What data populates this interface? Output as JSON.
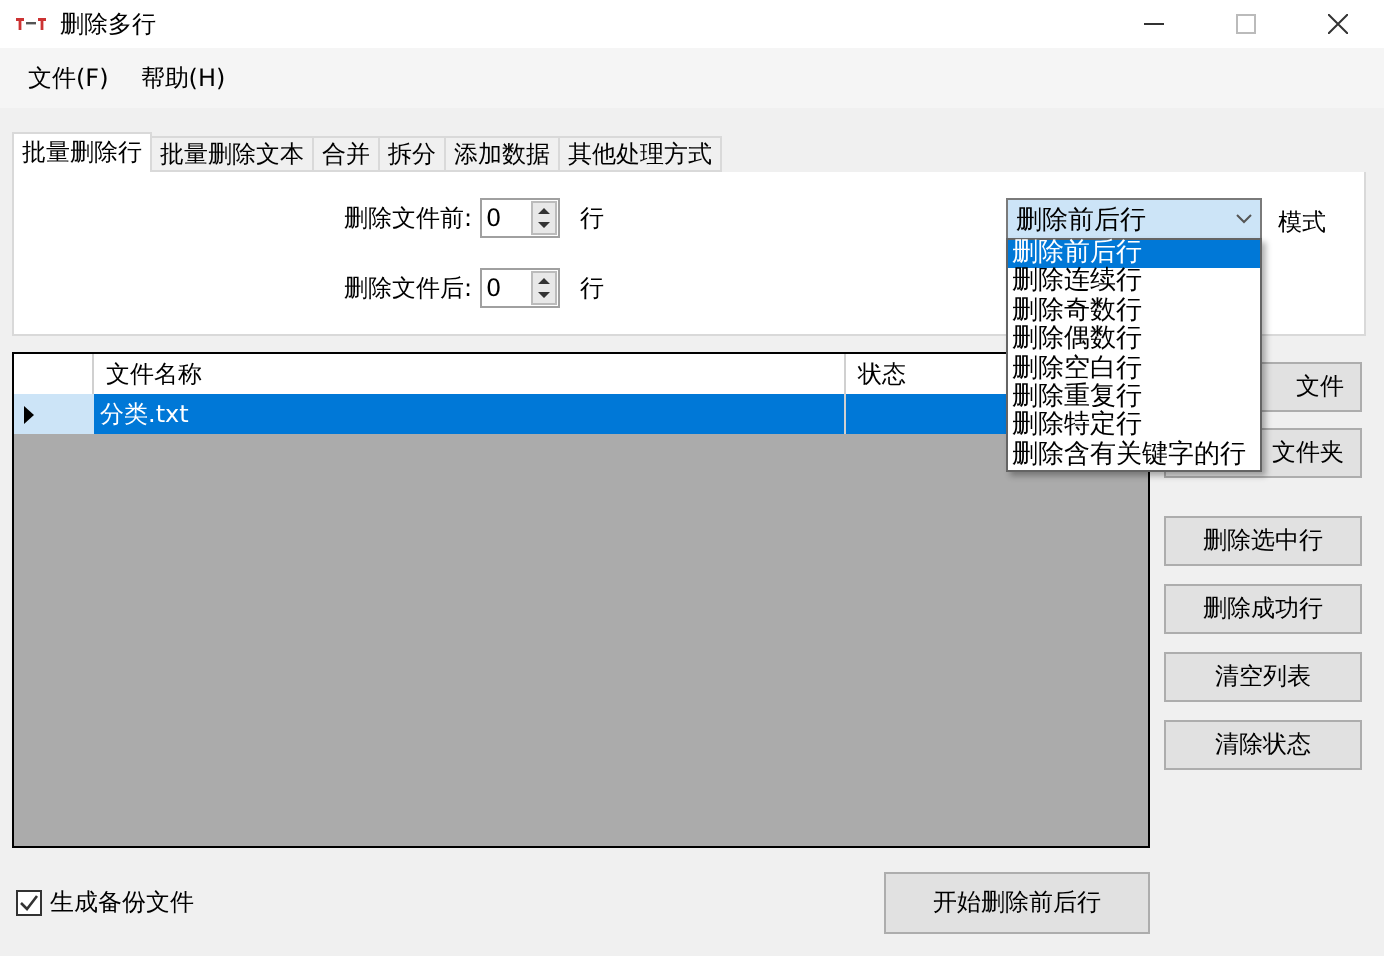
{
  "window": {
    "title": "删除多行"
  },
  "menu": [
    "文件(F)",
    "帮助(H)"
  ],
  "tabs": [
    {
      "label": "批量删除行",
      "selected": true
    },
    {
      "label": "批量删除文本",
      "selected": false
    },
    {
      "label": "合并",
      "selected": false
    },
    {
      "label": "拆分",
      "selected": false
    },
    {
      "label": "添加数据",
      "selected": false
    },
    {
      "label": "其他处理方式",
      "selected": false
    }
  ],
  "fields": [
    {
      "label": "删除文件前:",
      "value": "0",
      "unit": "行"
    },
    {
      "label": "删除文件后:",
      "value": "0",
      "unit": "行"
    }
  ],
  "mode": {
    "value": "删除前后行",
    "label": "模式",
    "expanded": true,
    "options": [
      {
        "label": "删除前后行",
        "selected": true
      },
      {
        "label": "删除连续行",
        "selected": false
      },
      {
        "label": "删除奇数行",
        "selected": false
      },
      {
        "label": "删除偶数行",
        "selected": false
      },
      {
        "label": "删除空白行",
        "selected": false
      },
      {
        "label": "删除重复行",
        "selected": false
      },
      {
        "label": "删除特定行",
        "selected": false
      },
      {
        "label": "删除含有关键字的行",
        "selected": false
      }
    ]
  },
  "table": {
    "columns": [
      "文件名称",
      "状态"
    ],
    "rows": [
      {
        "name": "分类.txt",
        "selected": true
      }
    ]
  },
  "side_buttons": [
    {
      "label": "文件",
      "partly_covered": true
    },
    {
      "label": "文件夹",
      "partly_covered": true
    },
    {
      "label": "删除选中行",
      "partly_covered": false
    },
    {
      "label": "删除成功行",
      "partly_covered": false
    },
    {
      "label": "清空列表",
      "partly_covered": false
    },
    {
      "label": "清除状态",
      "partly_covered": false
    }
  ],
  "backup": {
    "label": "生成备份文件",
    "checked": true
  },
  "start_button": "开始删除前后行"
}
